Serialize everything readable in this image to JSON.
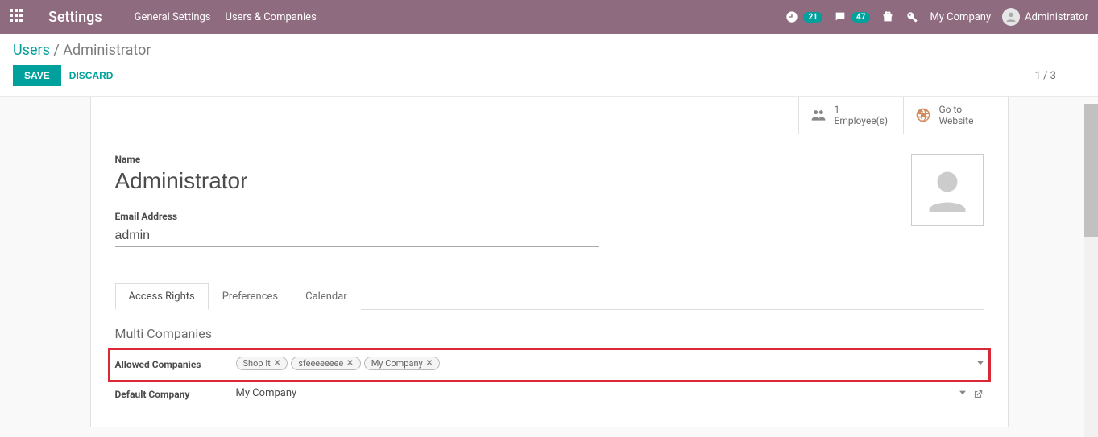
{
  "topbar": {
    "title": "Settings",
    "nav": [
      "General Settings",
      "Users & Companies"
    ],
    "activities_count": "21",
    "discuss_count": "47",
    "company": "My Company",
    "user": "Administrator"
  },
  "breadcrumb": {
    "root": "Users",
    "current": "Administrator"
  },
  "buttons": {
    "save": "SAVE",
    "discard": "DISCARD"
  },
  "pager": {
    "text": "1 / 3"
  },
  "statbuttons": {
    "employees": {
      "count": "1",
      "label": "Employee(s)"
    },
    "website": {
      "line1": "Go to",
      "line2": "Website"
    }
  },
  "form": {
    "name_label": "Name",
    "name_value": "Administrator",
    "email_label": "Email Address",
    "email_value": "admin"
  },
  "tabs": [
    "Access Rights",
    "Preferences",
    "Calendar"
  ],
  "multi": {
    "title": "Multi Companies",
    "allowed_label": "Allowed Companies",
    "tags": [
      "Shop It",
      "sfeeeeeeee",
      "My Company"
    ],
    "default_label": "Default Company",
    "default_value": "My Company"
  }
}
